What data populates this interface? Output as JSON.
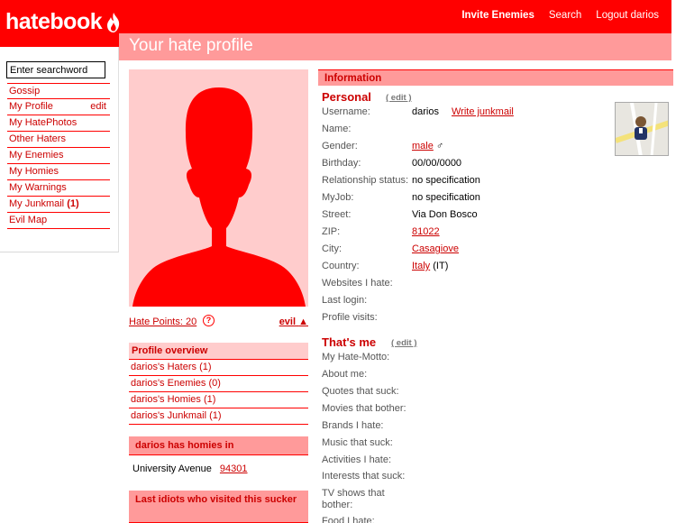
{
  "brand": {
    "name": "hatebook"
  },
  "topnav": {
    "invite": "Invite Enemies",
    "search": "Search",
    "logout": "Logout darios"
  },
  "page_title": "Your hate profile",
  "search": {
    "placeholder": "Enter searchword"
  },
  "leftnav": {
    "gossip": "Gossip",
    "my_profile": "My Profile",
    "edit": "edit",
    "hatephotos": "My HatePhotos",
    "other_haters": "Other Haters",
    "enemies": "My Enemies",
    "homies": "My Homies",
    "warnings": "My Warnings",
    "junkmail": "My Junkmail",
    "junkmail_count": "(1)",
    "evil_map": "Evil Map"
  },
  "photo_column": {
    "hate_points": "Hate Points: 20",
    "help": "?",
    "evil": "evil",
    "overview_title": "Profile overview",
    "overview": [
      "darios's Haters (1)",
      "darios's Enemies (0)",
      "darios's Homies (1)",
      "darios's Junkmail (1)"
    ],
    "homies_title": "darios has homies in",
    "homie_place": "University Avenue",
    "homie_zip": "94301",
    "visitors_title": "Last idiots who visited this sucker"
  },
  "info": {
    "header": "Information",
    "personal_title": "Personal",
    "edit": "( edit )",
    "username_label": "Username:",
    "username": "darios",
    "write_junkmail": "Write junkmail",
    "name_label": "Name:",
    "gender_label": "Gender:",
    "gender": "male",
    "gender_symbol": "♂",
    "birthday_label": "Birthday:",
    "birthday": "00/00/0000",
    "relationship_label": "Relationship status:",
    "relationship": "no specification",
    "job_label": "MyJob:",
    "job": "no specification",
    "street_label": "Street:",
    "street": "Via Don Bosco",
    "zip_label": "ZIP:",
    "zip": "81022",
    "city_label": "City:",
    "city": "Casagiove",
    "country_label": "Country:",
    "country": "Italy",
    "country_code": "(IT)",
    "websites_label": "Websites I hate:",
    "lastlogin_label": "Last login:",
    "visits_label": "Profile visits:",
    "thatsme_title": "That's me",
    "motto_label": "My Hate-Motto:",
    "about_label": "About me:",
    "quotes_label": "Quotes that suck:",
    "movies_label": "Movies that bother:",
    "brands_label": "Brands I hate:",
    "music_label": "Music that suck:",
    "activities_label": "Activities I hate:",
    "interests_label": "Interests that suck:",
    "tv_label": "TV shows that bother:",
    "food_label": "Food I hate:"
  },
  "colors": {
    "brand_red": "#ff0000",
    "pink": "#ff9a9a",
    "light_pink": "#ffcccc",
    "link_red": "#cc0000"
  }
}
